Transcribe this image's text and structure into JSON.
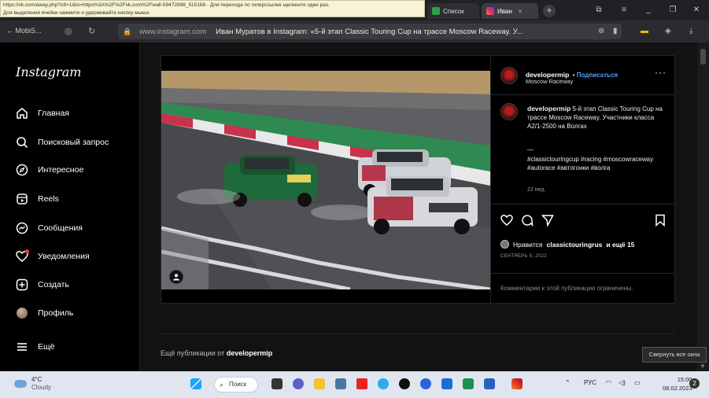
{
  "browser": {
    "tooltip_line1": "https://vk.com/away.php?utf=1&to=https%3A%2F%2Fvk.com%2Fwall-59472898_515168 - Для перехода по гиперссылке щелкните один раз.",
    "tooltip_line2": "Для выделения ячейки нажмите и удерживайте кнопку мыши.",
    "tabs": [
      {
        "label": "Список"
      },
      {
        "label": "Иван"
      }
    ],
    "back_label": "← MobiS...",
    "host": "www.instagram.com",
    "page_title": "Иван Муратов в Instagram: «5-й этап Classic Touring Cup на трассе Moscow Raceway. У..."
  },
  "sidebar": {
    "logo": "Instagram",
    "items": [
      {
        "label": "Главная",
        "icon": "home-icon"
      },
      {
        "label": "Поисковый запрос",
        "icon": "search-icon"
      },
      {
        "label": "Интересное",
        "icon": "compass-icon"
      },
      {
        "label": "Reels",
        "icon": "reels-icon"
      },
      {
        "label": "Сообщения",
        "icon": "messenger-icon"
      },
      {
        "label": "Уведомления",
        "icon": "heart-icon"
      },
      {
        "label": "Создать",
        "icon": "plus-square-icon"
      },
      {
        "label": "Профиль",
        "icon": "avatar"
      },
      {
        "label": "Ещё",
        "icon": "menu-icon"
      }
    ]
  },
  "post": {
    "username": "developermip",
    "follow_label": "Подписаться",
    "location": "Moscow Raceway",
    "caption": "5-й этап Classic Touring Cup на трассе Moscow Raceway. Участники класса А2/1-2500 на Волгах",
    "separator": "—",
    "hashtags": "#classictouringcup #racing #moscowraceway #autorace #автогонки #волга",
    "age": "22 нед.",
    "likes_prefix": "Нравится",
    "likes_user": "classictouringrus",
    "likes_suffix": "и ещё 15",
    "date": "СЕНТЯБРЬ 5, 2022",
    "comments_disabled": "Комментарии к этой публикации ограничены.",
    "more_prefix": "Ещё публикации от",
    "more_user": "developermip"
  },
  "tooltip_collapse": "Свернуть все окна",
  "taskbar": {
    "temp": "4°C",
    "weather": "Cloudy",
    "search_label": "Поиск",
    "lang": "РУС",
    "time": "15:00",
    "date": "08.02.2023"
  }
}
